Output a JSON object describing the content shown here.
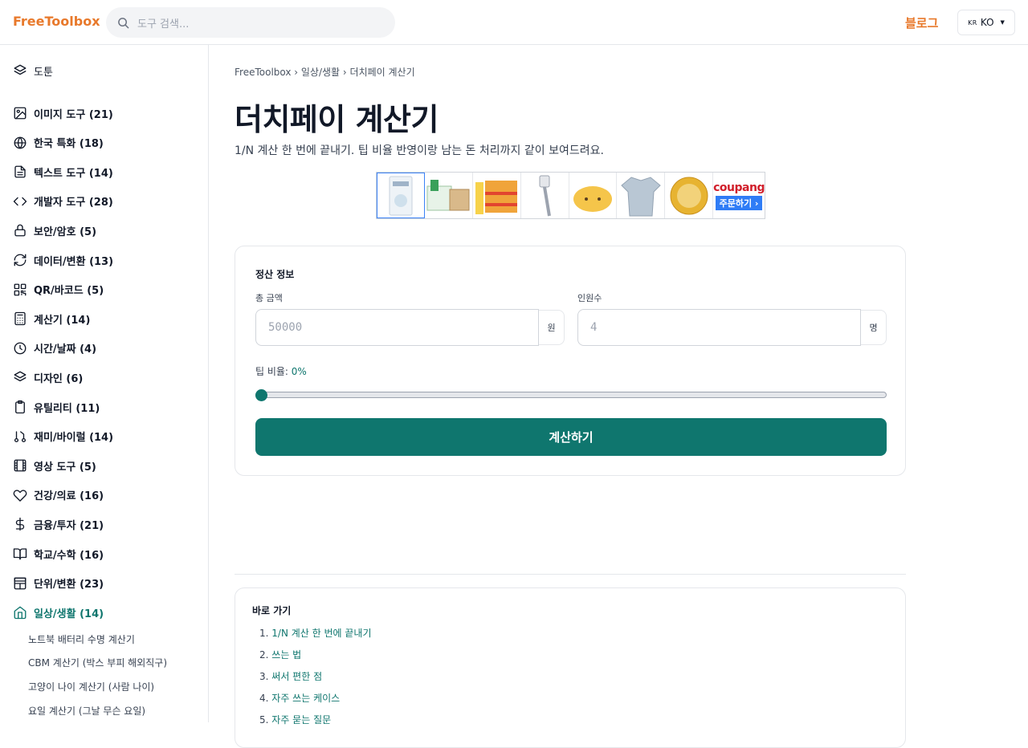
{
  "header": {
    "logo": "FreeToolbox",
    "search_placeholder": "도구 검색...",
    "blog": "블로그",
    "lang_flag": "KR",
    "lang": "KO"
  },
  "sidebar": {
    "top_item": "도툰",
    "categories": [
      {
        "label": "이미지 도구 (21)",
        "icon": "image-icon"
      },
      {
        "label": "한국 특화 (18)",
        "icon": "globe-icon"
      },
      {
        "label": "텍스트 도구 (14)",
        "icon": "document-icon"
      },
      {
        "label": "개발자 도구 (28)",
        "icon": "code-icon"
      },
      {
        "label": "보안/암호 (5)",
        "icon": "lock-icon"
      },
      {
        "label": "데이터/변환 (13)",
        "icon": "refresh-icon"
      },
      {
        "label": "QR/바코드 (5)",
        "icon": "qr-icon"
      },
      {
        "label": "계산기 (14)",
        "icon": "calculator-icon"
      },
      {
        "label": "시간/날짜 (4)",
        "icon": "clock-icon"
      },
      {
        "label": "디자인 (6)",
        "icon": "layers-icon"
      },
      {
        "label": "유틸리티 (11)",
        "icon": "clipboard-icon"
      },
      {
        "label": "재미/바이럴 (14)",
        "icon": "fun-icon"
      },
      {
        "label": "영상 도구 (5)",
        "icon": "film-icon"
      },
      {
        "label": "건강/의료 (16)",
        "icon": "heart-icon"
      },
      {
        "label": "금융/투자 (21)",
        "icon": "dollar-icon"
      },
      {
        "label": "학교/수학 (16)",
        "icon": "book-icon"
      },
      {
        "label": "단위/변환 (23)",
        "icon": "grid-icon"
      },
      {
        "label": "일상/생활 (14)",
        "icon": "home-icon"
      }
    ],
    "sub_items": [
      "노트북 배터리 수명 계산기",
      "CBM 계산기 (박스 부피 해외직구)",
      "고양이 나이 계산기 (사람 나이)",
      "요일 계산기 (그날 무슨 요일)"
    ]
  },
  "main": {
    "breadcrumb": "FreeToolbox › 일상/생활 › 더치페이 계산기",
    "title": "더치페이 계산기",
    "description": "1/N 계산 한 번에 끝내기. 팁 비율 반영이랑 남는 돈 처리까지 같이 보여드려요.",
    "ad": {
      "brand": "coupang",
      "order": "주문하기 ›"
    },
    "form": {
      "section_title": "정산 정보",
      "total_label": "총 금액",
      "total_placeholder": "50000",
      "total_unit": "원",
      "people_label": "인원수",
      "people_placeholder": "4",
      "people_unit": "명",
      "tip_label": "팁 비율: ",
      "tip_value": "0%",
      "tip_fraction": 0,
      "calc_button": "계산하기"
    },
    "toc": {
      "title": "바로 가기",
      "items": [
        {
          "num": "1.",
          "label": "1/N 계산 한 번에 끝내기"
        },
        {
          "num": "2.",
          "label": "쓰는 법"
        },
        {
          "num": "3.",
          "label": "써서 편한 점"
        },
        {
          "num": "4.",
          "label": "자주 쓰는 케이스"
        },
        {
          "num": "5.",
          "label": "자주 묻는 질문"
        }
      ]
    }
  },
  "colors": {
    "brand": "#e8792b",
    "accent": "#0f766e",
    "coupang": "#d11e2a"
  }
}
